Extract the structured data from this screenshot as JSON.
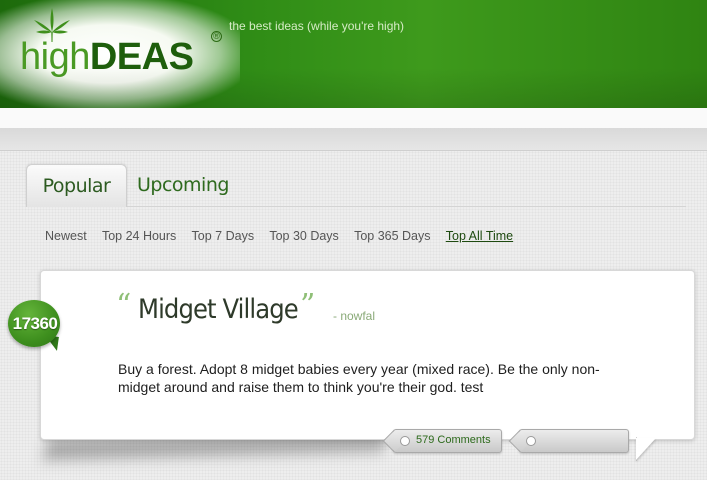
{
  "header": {
    "logo_high": "high",
    "logo_deas": "DEAS",
    "registered": "®",
    "tagline": "the best ideas (while you're high)"
  },
  "tabs": [
    {
      "label": "Popular",
      "active": true
    },
    {
      "label": "Upcoming",
      "active": false
    }
  ],
  "filters": [
    {
      "label": "Newest",
      "active": false
    },
    {
      "label": "Top 24 Hours",
      "active": false
    },
    {
      "label": "Top 7 Days",
      "active": false
    },
    {
      "label": "Top 30 Days",
      "active": false
    },
    {
      "label": "Top 365 Days",
      "active": false
    },
    {
      "label": "Top All Time",
      "active": true
    }
  ],
  "idea": {
    "score": "17360",
    "open_quote": "“",
    "close_quote": "”",
    "title": "Midget Village",
    "author": "- nowfal",
    "body": "Buy a forest. Adopt 8 midget babies every year (mixed race). Be the only non-midget around and raise them to think you're their god. test",
    "comments_label": "579 Comments"
  },
  "colors": {
    "brand_green": "#2f8c16",
    "score_green": "#3e8f1e",
    "link_green": "#2d6a1c"
  },
  "icons": {
    "logo": "cannabis-leaf-icon"
  }
}
